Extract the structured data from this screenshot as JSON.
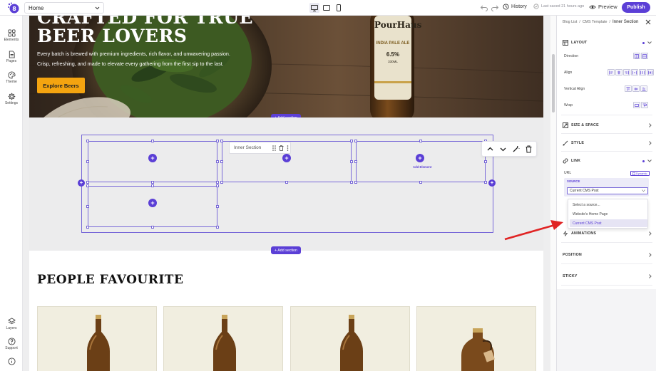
{
  "topbar": {
    "page_select": "Home",
    "history_label": "History",
    "saved_text": "Last saved 21 hours ago",
    "preview_label": "Preview",
    "publish_label": "Publish"
  },
  "left_rail": [
    {
      "label": "Elements",
      "icon": "grid-icon"
    },
    {
      "label": "Pages",
      "icon": "page-icon"
    },
    {
      "label": "Theme",
      "icon": "palette-icon"
    },
    {
      "label": "Settings",
      "icon": "gear-icon"
    },
    {
      "label": "Layers",
      "icon": "layers-icon"
    },
    {
      "label": "Support",
      "icon": "help-icon"
    }
  ],
  "hero": {
    "title": "CRAFTED FOR TRUE\nBEER LOVERS",
    "text": "Every batch is brewed with premium ingredients, rich flavor, and unwavering passion. Crisp, refreshing, and made to elevate every gathering from the first sip to the last.",
    "button": "Explore Beers",
    "bottle_brand": "PourHaus",
    "bottle_type": "INDIA PALE ALE",
    "bottle_abv": "6.5%",
    "bottle_volume": "330ML"
  },
  "canvas": {
    "add_section": "+ Add section",
    "inner_section_label": "Inner Section",
    "add_element": "Add Element",
    "people_title": "PEOPLE FAVOURITE"
  },
  "panel": {
    "breadcrumb": [
      "Blog List",
      "CMS Template",
      "Inner Section"
    ],
    "layout_title": "LAYOUT",
    "direction_label": "Direction",
    "align_label": "Align",
    "vertical_align_label": "Vertical Align",
    "wrap_label": "Wrap",
    "size_space_title": "SIZE & SPACE",
    "style_title": "STYLE",
    "link_title": "LINK",
    "url_label": "URL",
    "dynamic_label": "Dynamic",
    "source_label": "SOURCE",
    "source_value": "Current CMS Post",
    "source_options": [
      "Select a source...",
      "Website's Home Page",
      "Current CMS Post"
    ],
    "animations_title": "ANIMATIONS",
    "position_title": "POSITION",
    "sticky_title": "STICKY"
  },
  "colors": {
    "accent": "#5b3fd6",
    "hero_button": "#f4a410",
    "arrow": "#e02424"
  }
}
